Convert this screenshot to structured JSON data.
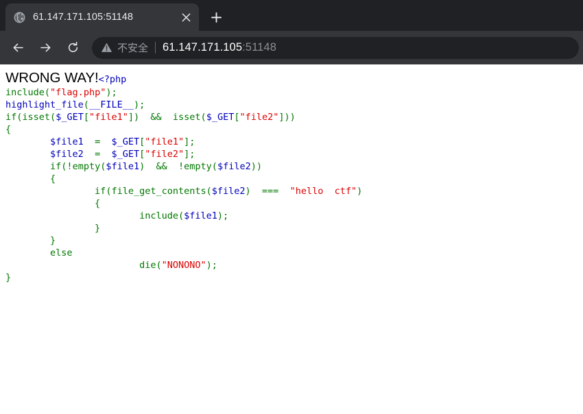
{
  "browser": {
    "tab": {
      "title": "61.147.171.105:51148",
      "favicon": "globe-icon",
      "close_label": "×"
    },
    "newtab_label": "+",
    "nav": {
      "back_label": "←",
      "forward_label": "→",
      "reload_label": "⟳"
    },
    "omnibox": {
      "warning_icon": "warning-triangle-icon",
      "security_text": "不安全",
      "url_host": "61.147.171.105",
      "url_rest": ":51148"
    }
  },
  "page": {
    "heading": "WRONG WAY!",
    "code": {
      "open_tag": "<?php",
      "lines": [
        [
          {
            "t": "include",
            "c": "keyword"
          },
          {
            "t": "(",
            "c": "keyword"
          },
          {
            "t": "\"flag.php\"",
            "c": "string"
          },
          {
            "t": ");",
            "c": "keyword"
          }
        ],
        [
          {
            "t": "highlight_file",
            "c": "default"
          },
          {
            "t": "(",
            "c": "keyword"
          },
          {
            "t": "__FILE__",
            "c": "default"
          },
          {
            "t": ");",
            "c": "keyword"
          }
        ],
        [
          {
            "t": "if",
            "c": "keyword"
          },
          {
            "t": "(",
            "c": "keyword"
          },
          {
            "t": "isset",
            "c": "keyword"
          },
          {
            "t": "(",
            "c": "keyword"
          },
          {
            "t": "$_GET",
            "c": "default"
          },
          {
            "t": "[",
            "c": "keyword"
          },
          {
            "t": "\"file1\"",
            "c": "string"
          },
          {
            "t": "])  &&  ",
            "c": "keyword"
          },
          {
            "t": "isset",
            "c": "keyword"
          },
          {
            "t": "(",
            "c": "keyword"
          },
          {
            "t": "$_GET",
            "c": "default"
          },
          {
            "t": "[",
            "c": "keyword"
          },
          {
            "t": "\"file2\"",
            "c": "string"
          },
          {
            "t": "]))",
            "c": "keyword"
          }
        ],
        [
          {
            "t": "{",
            "c": "keyword"
          }
        ],
        [
          {
            "t": "        ",
            "c": "keyword"
          },
          {
            "t": "$file1",
            "c": "default"
          },
          {
            "t": "  =  ",
            "c": "keyword"
          },
          {
            "t": "$_GET",
            "c": "default"
          },
          {
            "t": "[",
            "c": "keyword"
          },
          {
            "t": "\"file1\"",
            "c": "string"
          },
          {
            "t": "];",
            "c": "keyword"
          }
        ],
        [
          {
            "t": "        ",
            "c": "keyword"
          },
          {
            "t": "$file2",
            "c": "default"
          },
          {
            "t": "  =  ",
            "c": "keyword"
          },
          {
            "t": "$_GET",
            "c": "default"
          },
          {
            "t": "[",
            "c": "keyword"
          },
          {
            "t": "\"file2\"",
            "c": "string"
          },
          {
            "t": "];",
            "c": "keyword"
          }
        ],
        [
          {
            "t": "        ",
            "c": "keyword"
          },
          {
            "t": "if",
            "c": "keyword"
          },
          {
            "t": "(!",
            "c": "keyword"
          },
          {
            "t": "empty",
            "c": "keyword"
          },
          {
            "t": "(",
            "c": "keyword"
          },
          {
            "t": "$file1",
            "c": "default"
          },
          {
            "t": ")  &&  !",
            "c": "keyword"
          },
          {
            "t": "empty",
            "c": "keyword"
          },
          {
            "t": "(",
            "c": "keyword"
          },
          {
            "t": "$file2",
            "c": "default"
          },
          {
            "t": "))",
            "c": "keyword"
          }
        ],
        [
          {
            "t": "        {",
            "c": "keyword"
          }
        ],
        [
          {
            "t": "                ",
            "c": "keyword"
          },
          {
            "t": "if",
            "c": "keyword"
          },
          {
            "t": "(",
            "c": "keyword"
          },
          {
            "t": "file_get_contents",
            "c": "keyword"
          },
          {
            "t": "(",
            "c": "keyword"
          },
          {
            "t": "$file2",
            "c": "default"
          },
          {
            "t": ")  ===  ",
            "c": "keyword"
          },
          {
            "t": "\"hello  ctf\"",
            "c": "string"
          },
          {
            "t": ")",
            "c": "keyword"
          }
        ],
        [
          {
            "t": "                {",
            "c": "keyword"
          }
        ],
        [
          {
            "t": "                        ",
            "c": "keyword"
          },
          {
            "t": "include",
            "c": "keyword"
          },
          {
            "t": "(",
            "c": "keyword"
          },
          {
            "t": "$file1",
            "c": "default"
          },
          {
            "t": ");",
            "c": "keyword"
          }
        ],
        [
          {
            "t": "                }",
            "c": "keyword"
          }
        ],
        [
          {
            "t": "        }",
            "c": "keyword"
          }
        ],
        [
          {
            "t": "        ",
            "c": "keyword"
          },
          {
            "t": "else",
            "c": "keyword"
          }
        ],
        [
          {
            "t": "                        ",
            "c": "keyword"
          },
          {
            "t": "die",
            "c": "keyword"
          },
          {
            "t": "(",
            "c": "keyword"
          },
          {
            "t": "\"NONONO\"",
            "c": "string"
          },
          {
            "t": ");",
            "c": "keyword"
          }
        ],
        [
          {
            "t": "}",
            "c": "keyword"
          }
        ]
      ]
    }
  },
  "colors": {
    "php_default": "#0000BB",
    "php_keyword": "#007700",
    "php_string": "#DD0000",
    "chrome_tabstrip": "#202124",
    "chrome_toolbar": "#35363a",
    "page_background": "#ffffff"
  }
}
